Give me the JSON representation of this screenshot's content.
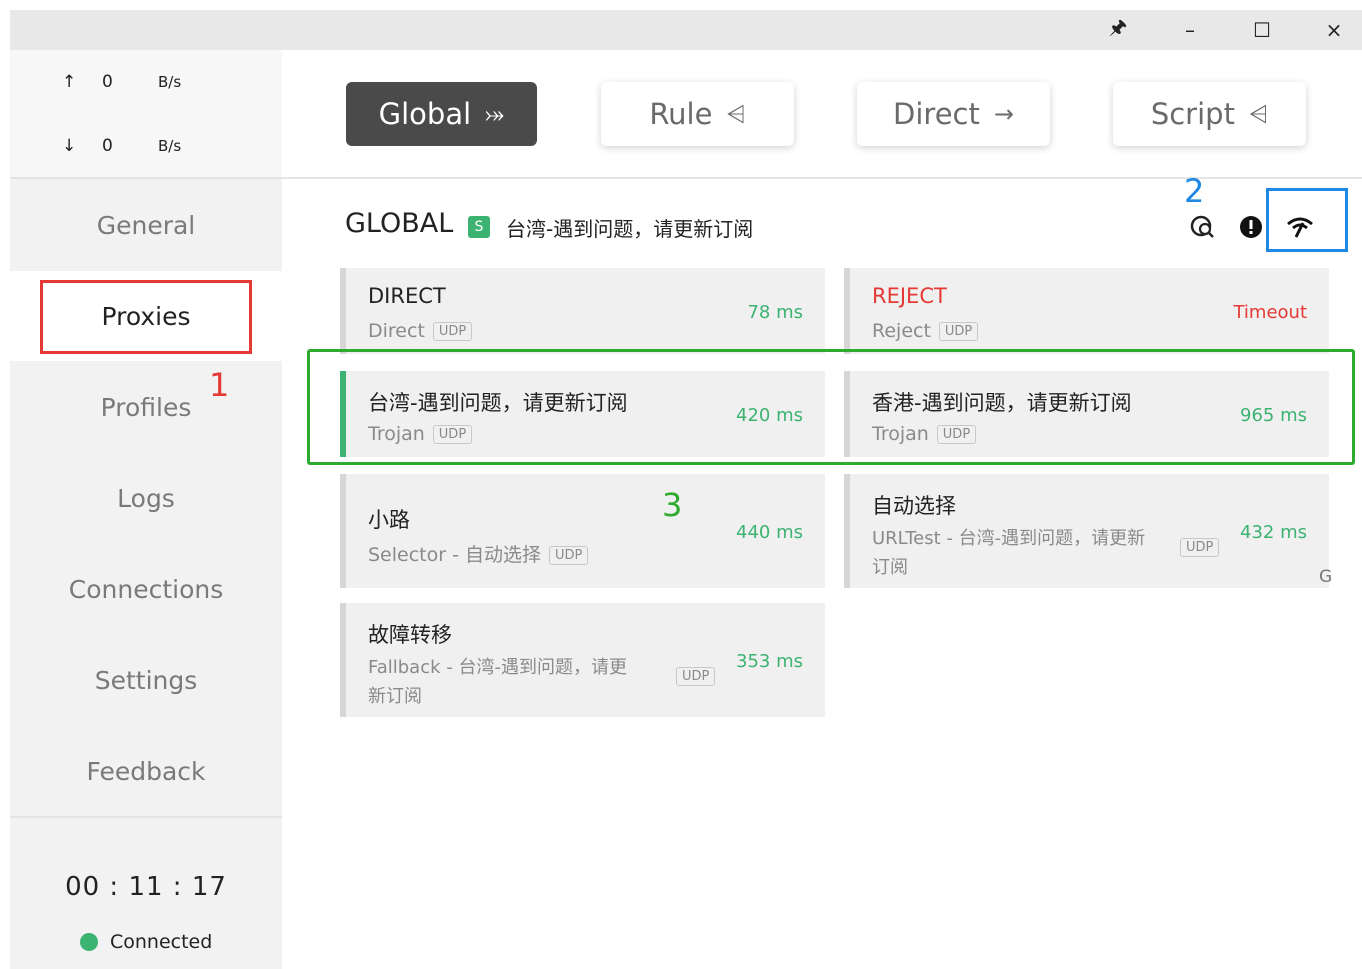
{
  "window": {
    "controls": [
      "🖈",
      "–",
      "☐",
      "×"
    ]
  },
  "traffic": {
    "up_arrow": "↑",
    "up_value": "0",
    "up_unit": "B/s",
    "down_arrow": "↓",
    "down_value": "0",
    "down_unit": "B/s"
  },
  "nav": {
    "items": [
      "General",
      "Proxies",
      "Profiles",
      "Logs",
      "Connections",
      "Settings",
      "Feedback"
    ],
    "active": "Proxies"
  },
  "status": {
    "uptime": "00 : 11 : 17",
    "connection": "Connected",
    "connection_color": "#3cb371"
  },
  "modes": [
    {
      "label": "Global",
      "icon": "⤖",
      "active": true
    },
    {
      "label": "Rule",
      "icon": "⩤",
      "active": false
    },
    {
      "label": "Direct",
      "icon": "→",
      "active": false
    },
    {
      "label": "Script",
      "icon": "⩤",
      "active": false
    }
  ],
  "group": {
    "title": "GLOBAL",
    "badge": "S",
    "now": "台湾-遇到问题，请更新订阅"
  },
  "header_icons": [
    "locate-icon",
    "info-icon",
    "latency-test-icon"
  ],
  "proxies": [
    {
      "name": "DIRECT",
      "type": "Direct",
      "udp": "UDP",
      "latency": "78 ms",
      "status": "ok"
    },
    {
      "name": "REJECT",
      "type": "Reject",
      "udp": "UDP",
      "latency": "Timeout",
      "status": "error"
    },
    {
      "name": "台湾-遇到问题，请更新订阅",
      "type": "Trojan",
      "udp": "UDP",
      "latency": "420 ms",
      "status": "ok",
      "selected": true
    },
    {
      "name": "香港-遇到问题，请更新订阅",
      "type": "Trojan",
      "udp": "UDP",
      "latency": "965 ms",
      "status": "ok"
    },
    {
      "name": "小路",
      "type": "Selector - 自动选择",
      "udp": "UDP",
      "latency": "440 ms",
      "status": "ok"
    },
    {
      "name": "自动选择",
      "type_line1": "URLTest - 台湾-遇到问题，请更新",
      "type_line2": "订阅",
      "udp": "UDP",
      "latency": "432 ms",
      "status": "ok",
      "group_mark": "G"
    },
    {
      "name": "故障转移",
      "type_line1": "Fallback - 台湾-遇到问题，请更",
      "type_line2": "新订阅",
      "udp": "UDP",
      "latency": "353 ms",
      "status": "ok"
    }
  ],
  "annotations": {
    "n1": "1",
    "n2": "2",
    "n3": "3",
    "red": "#e53935",
    "blue": "#1e88e5",
    "green": "#2eaa2e"
  }
}
